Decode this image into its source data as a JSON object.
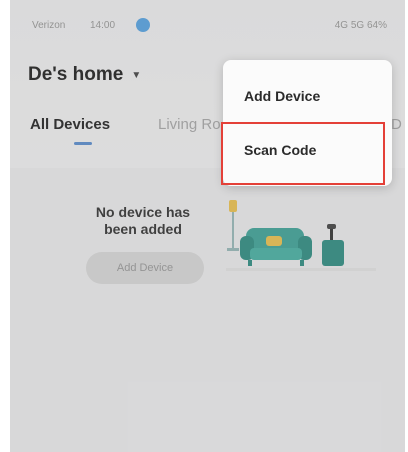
{
  "status_bar": {
    "left_text": "Verizon",
    "time": "14:00",
    "right_text": "4G 5G 64%"
  },
  "header": {
    "home_name": "De's home",
    "caret_icon": "caret-down-icon"
  },
  "tabs": [
    {
      "label": "All Devices",
      "active": true
    },
    {
      "label": "Living Ro",
      "active": false
    }
  ],
  "tab_edge_text": "D",
  "empty_state": {
    "message": "No device has been added",
    "button_label": "Add Device",
    "illustration": "sofa-lamp-illustration"
  },
  "dropdown_menu": {
    "items": [
      {
        "label": "Add Device"
      },
      {
        "label": "Scan Code"
      }
    ]
  },
  "colors": {
    "accent": "#5b8fd1",
    "highlight": "#e44038",
    "illustration_teal": "#3fa59a",
    "illustration_yellow": "#f0c54f"
  }
}
